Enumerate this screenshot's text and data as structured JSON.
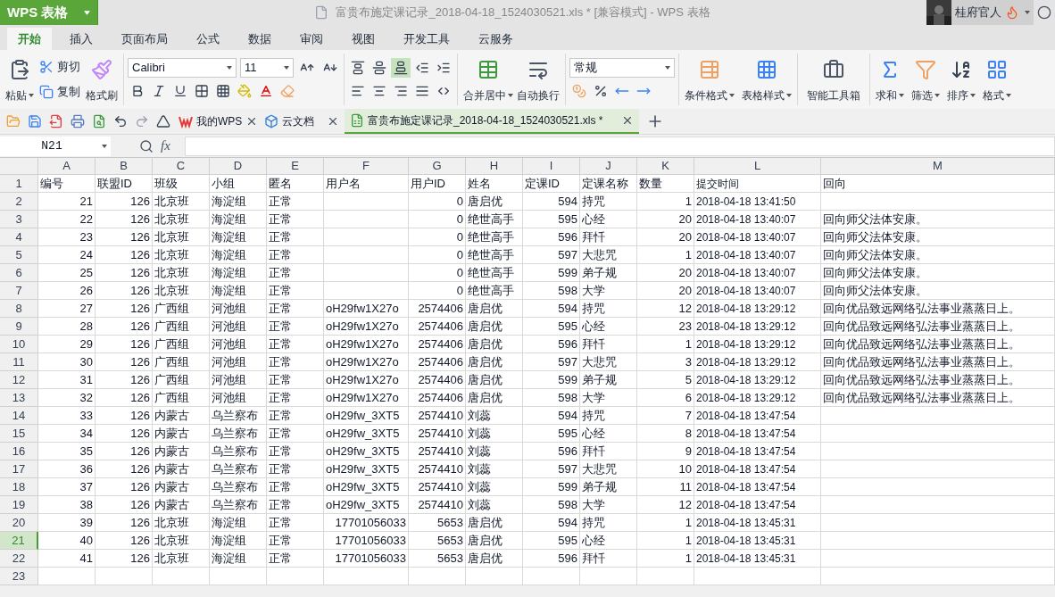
{
  "app_menu": {
    "label": "WPS 表格"
  },
  "window": {
    "title": "富贵布施定课记录_2018-04-18_1524030521.xls * [兼容模式] - WPS 表格"
  },
  "user": {
    "name": "桂府官人"
  },
  "ribbon_tabs": [
    {
      "label": "开始",
      "selected": true
    },
    {
      "label": "插入",
      "selected": false
    },
    {
      "label": "页面布局",
      "selected": false
    },
    {
      "label": "公式",
      "selected": false
    },
    {
      "label": "数据",
      "selected": false
    },
    {
      "label": "审阅",
      "selected": false
    },
    {
      "label": "视图",
      "selected": false
    },
    {
      "label": "开发工具",
      "selected": false
    },
    {
      "label": "云服务",
      "selected": false
    }
  ],
  "ribbon": {
    "paste": "粘贴",
    "cut": "剪切",
    "copy": "复制",
    "format_painter": "格式刷",
    "font_name": "Calibri",
    "font_size": "11",
    "vertical_align": [
      {
        "selected": false
      },
      {
        "selected": false
      },
      {
        "selected": true
      }
    ],
    "merge": "合并居中",
    "wrap": "自动换行",
    "number_format": "常规",
    "conditional_format": "条件格式",
    "table_style": "表格样式",
    "toolbox": "智能工具箱",
    "editing": [
      "求和",
      "筛选",
      "排序",
      "格式"
    ]
  },
  "doc_tabs": [
    {
      "label": "我的WPS",
      "kind": "wps",
      "selected": false
    },
    {
      "label": "云文档",
      "kind": "cloud",
      "selected": false
    },
    {
      "label": "富贵布施定课记录_2018-04-18_1524030521.xls *",
      "kind": "sheet",
      "selected": true
    }
  ],
  "formula_bar": {
    "cell": "N21",
    "fx": "fx"
  },
  "sheet": {
    "columns": [
      "A",
      "B",
      "C",
      "D",
      "E",
      "F",
      "G",
      "H",
      "I",
      "J",
      "K",
      "L",
      "M"
    ],
    "rows": [
      {
        "num": "1",
        "selected": false,
        "cells": [
          "编号",
          "联盟ID",
          "班级",
          "小组",
          "匿名",
          "用户名",
          "用户ID",
          "姓名",
          "定课ID",
          "定课名称",
          "数量",
          "提交时间",
          "回向"
        ]
      },
      {
        "num": "2",
        "selected": false,
        "cells": [
          "21",
          "126",
          "北京班",
          "海淀组",
          "正常",
          null,
          "0",
          "唐启优",
          "594",
          "持咒",
          "1",
          "2018-04-18 13:41:50",
          null
        ]
      },
      {
        "num": "3",
        "selected": false,
        "cells": [
          "22",
          "126",
          "北京班",
          "海淀组",
          "正常",
          null,
          "0",
          "绝世高手",
          "595",
          "心经",
          "20",
          "2018-04-18 13:40:07",
          "回向师父法体安康。"
        ]
      },
      {
        "num": "4",
        "selected": false,
        "cells": [
          "23",
          "126",
          "北京班",
          "海淀组",
          "正常",
          null,
          "0",
          "绝世高手",
          "596",
          "拜忏",
          "20",
          "2018-04-18 13:40:07",
          "回向师父法体安康。"
        ]
      },
      {
        "num": "5",
        "selected": false,
        "cells": [
          "24",
          "126",
          "北京班",
          "海淀组",
          "正常",
          null,
          "0",
          "绝世高手",
          "597",
          "大悲咒",
          "1",
          "2018-04-18 13:40:07",
          "回向师父法体安康。"
        ]
      },
      {
        "num": "6",
        "selected": false,
        "cells": [
          "25",
          "126",
          "北京班",
          "海淀组",
          "正常",
          null,
          "0",
          "绝世高手",
          "599",
          "弟子规",
          "20",
          "2018-04-18 13:40:07",
          "回向师父法体安康。"
        ]
      },
      {
        "num": "7",
        "selected": false,
        "cells": [
          "26",
          "126",
          "北京班",
          "海淀组",
          "正常",
          null,
          "0",
          "绝世高手",
          "598",
          "大学",
          "20",
          "2018-04-18 13:40:07",
          "回向师父法体安康。"
        ]
      },
      {
        "num": "8",
        "selected": false,
        "cells": [
          "27",
          "126",
          "广西组",
          "河池组",
          "正常",
          "oH29fw1X27o",
          "2574406",
          "唐启优",
          "594",
          "持咒",
          "12",
          "2018-04-18 13:29:12",
          "回向优品致远网络弘法事业蒸蒸日上。"
        ]
      },
      {
        "num": "9",
        "selected": false,
        "cells": [
          "28",
          "126",
          "广西组",
          "河池组",
          "正常",
          "oH29fw1X27o",
          "2574406",
          "唐启优",
          "595",
          "心经",
          "23",
          "2018-04-18 13:29:12",
          "回向优品致远网络弘法事业蒸蒸日上。"
        ]
      },
      {
        "num": "10",
        "selected": false,
        "cells": [
          "29",
          "126",
          "广西组",
          "河池组",
          "正常",
          "oH29fw1X27o",
          "2574406",
          "唐启优",
          "596",
          "拜忏",
          "1",
          "2018-04-18 13:29:12",
          "回向优品致远网络弘法事业蒸蒸日上。"
        ]
      },
      {
        "num": "11",
        "selected": false,
        "cells": [
          "30",
          "126",
          "广西组",
          "河池组",
          "正常",
          "oH29fw1X27o",
          "2574406",
          "唐启优",
          "597",
          "大悲咒",
          "3",
          "2018-04-18 13:29:12",
          "回向优品致远网络弘法事业蒸蒸日上。"
        ]
      },
      {
        "num": "12",
        "selected": false,
        "cells": [
          "31",
          "126",
          "广西组",
          "河池组",
          "正常",
          "oH29fw1X27o",
          "2574406",
          "唐启优",
          "599",
          "弟子规",
          "5",
          "2018-04-18 13:29:12",
          "回向优品致远网络弘法事业蒸蒸日上。"
        ]
      },
      {
        "num": "13",
        "selected": false,
        "cells": [
          "32",
          "126",
          "广西组",
          "河池组",
          "正常",
          "oH29fw1X27o",
          "2574406",
          "唐启优",
          "598",
          "大学",
          "6",
          "2018-04-18 13:29:12",
          "回向优品致远网络弘法事业蒸蒸日上。"
        ]
      },
      {
        "num": "14",
        "selected": false,
        "cells": [
          "33",
          "126",
          "内蒙古",
          "乌兰察布",
          "正常",
          "oH29fw_3XT5",
          "2574410",
          "刘蕊",
          "594",
          "持咒",
          "7",
          "2018-04-18 13:47:54",
          null
        ]
      },
      {
        "num": "15",
        "selected": false,
        "cells": [
          "34",
          "126",
          "内蒙古",
          "乌兰察布",
          "正常",
          "oH29fw_3XT5",
          "2574410",
          "刘蕊",
          "595",
          "心经",
          "8",
          "2018-04-18 13:47:54",
          null
        ]
      },
      {
        "num": "16",
        "selected": false,
        "cells": [
          "35",
          "126",
          "内蒙古",
          "乌兰察布",
          "正常",
          "oH29fw_3XT5",
          "2574410",
          "刘蕊",
          "596",
          "拜忏",
          "9",
          "2018-04-18 13:47:54",
          null
        ]
      },
      {
        "num": "17",
        "selected": false,
        "cells": [
          "36",
          "126",
          "内蒙古",
          "乌兰察布",
          "正常",
          "oH29fw_3XT5",
          "2574410",
          "刘蕊",
          "597",
          "大悲咒",
          "10",
          "2018-04-18 13:47:54",
          null
        ]
      },
      {
        "num": "18",
        "selected": false,
        "cells": [
          "37",
          "126",
          "内蒙古",
          "乌兰察布",
          "正常",
          "oH29fw_3XT5",
          "2574410",
          "刘蕊",
          "599",
          "弟子规",
          "11",
          "2018-04-18 13:47:54",
          null
        ]
      },
      {
        "num": "19",
        "selected": false,
        "cells": [
          "38",
          "126",
          "内蒙古",
          "乌兰察布",
          "正常",
          "oH29fw_3XT5",
          "2574410",
          "刘蕊",
          "598",
          "大学",
          "12",
          "2018-04-18 13:47:54",
          null
        ]
      },
      {
        "num": "20",
        "selected": false,
        "cells": [
          "39",
          "126",
          "北京班",
          "海淀组",
          "正常",
          "17701056033",
          "5653",
          "唐启优",
          "594",
          "持咒",
          "1",
          "2018-04-18 13:45:31",
          null
        ]
      },
      {
        "num": "21",
        "selected": true,
        "cells": [
          "40",
          "126",
          "北京班",
          "海淀组",
          "正常",
          "17701056033",
          "5653",
          "唐启优",
          "595",
          "心经",
          "1",
          "2018-04-18 13:45:31",
          null
        ]
      },
      {
        "num": "22",
        "selected": false,
        "cells": [
          "41",
          "126",
          "北京班",
          "海淀组",
          "正常",
          "17701056033",
          "5653",
          "唐启优",
          "596",
          "拜忏",
          "1",
          "2018-04-18 13:45:31",
          null
        ]
      },
      {
        "num": "23",
        "selected": false,
        "cells": [
          null,
          null,
          null,
          null,
          null,
          null,
          null,
          null,
          null,
          null,
          null,
          null,
          null
        ]
      }
    ]
  }
}
